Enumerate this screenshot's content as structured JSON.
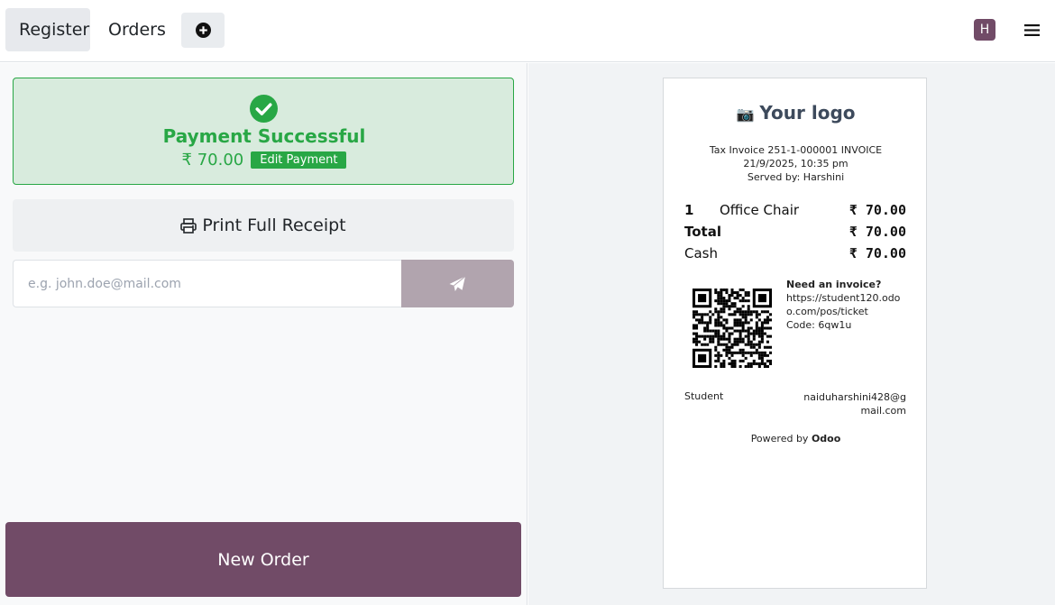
{
  "nav": {
    "register_label": "Register",
    "orders_label": "Orders",
    "user_initial": "H"
  },
  "payment": {
    "status": "Payment Successful",
    "amount": "₹ 70.00",
    "edit_label": "Edit Payment",
    "print_label": "Print Full Receipt",
    "email_placeholder": "e.g. john.doe@mail.com",
    "new_order_label": "New Order"
  },
  "receipt": {
    "logo_text": "Your logo",
    "invoice_line": "Tax Invoice 251-1-000001 INVOICE",
    "datetime": "21/9/2025, 10:35 pm",
    "served_by": "Served by: Harshini",
    "items": [
      {
        "qty": "1",
        "name": "Office Chair",
        "price": "₹ 70.00"
      }
    ],
    "total_label": "Total",
    "total_value": "₹ 70.00",
    "cash_label": "Cash",
    "cash_value": "₹ 70.00",
    "invoice_prompt": "Need an invoice?",
    "invoice_url": "https://student120.odoo.com/pos/ticket",
    "invoice_code": "Code: 6qw1u",
    "company": "Student",
    "company_email": "naiduharshini428@gmail.com",
    "powered_prefix": "Powered by",
    "powered_brand": "Odoo"
  },
  "colors": {
    "brand": "#714b67",
    "success": "#28a745",
    "success_bg": "#d8ebdd",
    "send_disabled": "#b1a4ae"
  },
  "icons": {
    "add": "plus-circle-icon",
    "menu": "hamburger-icon",
    "check": "check-circle-icon",
    "print": "printer-icon",
    "send": "paper-plane-icon",
    "camera": "camera-icon",
    "qr": "qr-code-icon"
  }
}
